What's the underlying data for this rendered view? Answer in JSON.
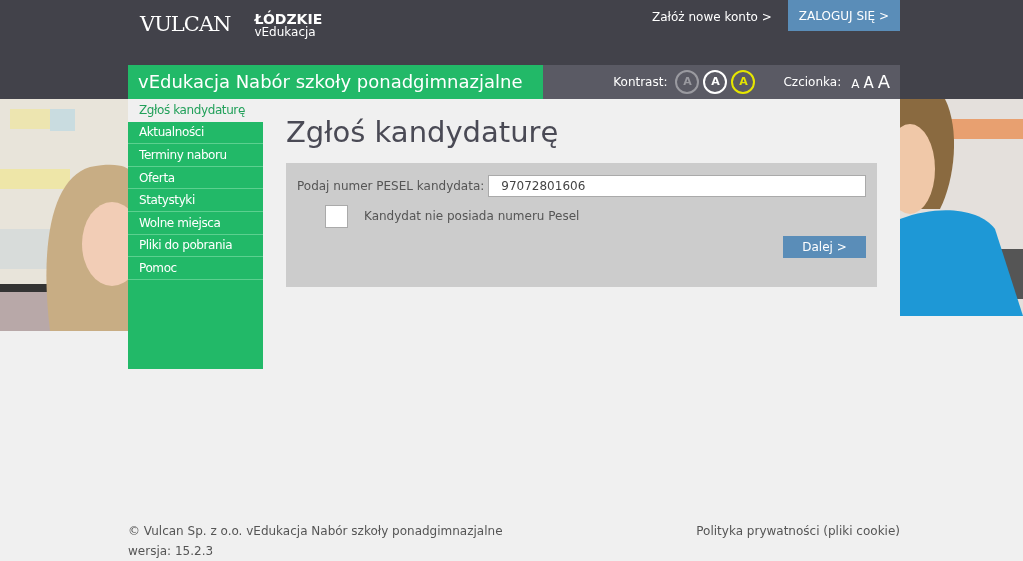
{
  "header": {
    "logo": "VULCAN",
    "region": "ŁÓDZKIE",
    "region_sub": "vEdukacja",
    "register_link": "Załóż nowe konto >",
    "login_button": "ZALOGUJ SIĘ >"
  },
  "title_bar": {
    "title": "vEdukacja Nabór szkoły ponadgimnazjalne",
    "contrast_label": "Kontrast:",
    "contrast_options": [
      {
        "label": "A",
        "color": "#9a9aa0"
      },
      {
        "label": "A",
        "color": "#ffffff"
      },
      {
        "label": "A",
        "color": "#e6e600"
      }
    ],
    "font_label": "Czcionka:",
    "font_options": [
      {
        "label": "A",
        "kind": "small"
      },
      {
        "label": "A",
        "kind": "medium"
      },
      {
        "label": "A",
        "kind": "large"
      }
    ]
  },
  "sidebar": {
    "items": [
      {
        "label": "Zgłoś kandydaturę",
        "selected": true
      },
      {
        "label": "Aktualności",
        "selected": false
      },
      {
        "label": "Terminy naboru",
        "selected": false
      },
      {
        "label": "Oferta",
        "selected": false
      },
      {
        "label": "Statystyki",
        "selected": false
      },
      {
        "label": "Wolne miejsca",
        "selected": false
      },
      {
        "label": "Pliki do pobrania",
        "selected": false
      },
      {
        "label": "Pomoc",
        "selected": false
      }
    ]
  },
  "main": {
    "heading": "Zgłoś kandydaturę",
    "pesel_label": "Podaj numer PESEL kandydata:",
    "pesel_value": "97072801606",
    "no_pesel_label": "Kandydat nie posiada numeru Pesel",
    "no_pesel_checked": false,
    "next_button": "Dalej >"
  },
  "footer": {
    "copyright": "© Vulcan Sp. z o.o. vEdukacja Nabór szkoły ponadgimnazjalne wersja: 15.2.3",
    "privacy_link": "Polityka prywatności (pliki cookie)"
  }
}
